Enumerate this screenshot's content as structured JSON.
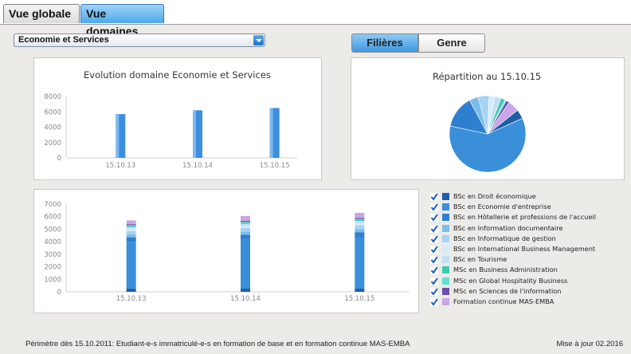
{
  "tabs": [
    {
      "label": "Vue globale",
      "active": false
    },
    {
      "label": "Vue domaines",
      "active": true
    }
  ],
  "domain_select": {
    "value": "Economie et Services"
  },
  "toggle": {
    "filieres": "Filières",
    "genre": "Genre",
    "active": "Filières"
  },
  "footer": {
    "note": "Périmètre dès 15.10.2011: Etudiant-e-s immatriculé-e-s en formation de base et en formation continue MAS-EMBA",
    "update": "Mise à jour 02.2016"
  },
  "chart_data": [
    {
      "type": "bar",
      "title": "Evolution domaine Economie et Services",
      "categories": [
        "15.10.13",
        "15.10.14",
        "15.10.15"
      ],
      "values": [
        5700,
        6200,
        6500
      ],
      "ylim": [
        0,
        8000
      ],
      "yticks": [
        "0",
        "2000",
        "4000",
        "6000",
        "8000"
      ],
      "color": "#3c8fdf"
    },
    {
      "type": "pie",
      "title": "Répartition au 15.10.15",
      "labels": [
        "BSc en Droit économique",
        "BSc en Economie d'entreprise",
        "BSc en Hôtellerie et professions de l'accueil",
        "BSc en Information documentaire",
        "BSc en Informatique de gestion",
        "BSc en International Business Management",
        "BSc en Tourisme",
        "MSc en Business Administration",
        "MSc en Global Hospitality Business",
        "MSc en Sciences de l'information",
        "Formation continue MAS-EMBA"
      ],
      "values": [
        260,
        3900,
        900,
        250,
        300,
        150,
        180,
        120,
        40,
        90,
        310
      ],
      "colors": [
        "#1f5ea8",
        "#3a8fd8",
        "#2f7fd0",
        "#7cbcec",
        "#a6d3f4",
        "#d5ebfb",
        "#c3dff5",
        "#3ec9b5",
        "#5fe0d0",
        "#6a4fb0",
        "#c9a6e6"
      ]
    },
    {
      "type": "bar",
      "stacked": true,
      "categories": [
        "15.10.13",
        "15.10.14",
        "15.10.15"
      ],
      "ylim": [
        0,
        7000
      ],
      "yticks": [
        "0",
        "1000",
        "2000",
        "3000",
        "4000",
        "5000",
        "6000",
        "7000"
      ],
      "series": [
        {
          "name": "BSc en Droit économique",
          "color": "#1f5ea8",
          "values": [
            250,
            255,
            260
          ]
        },
        {
          "name": "BSc en Economie d'entreprise",
          "color": "#3a8fd8",
          "values": [
            3750,
            3950,
            4100
          ]
        },
        {
          "name": "BSc en Hôtellerie et professions de l'accueil",
          "color": "#2f7fd0",
          "values": [
            350,
            350,
            400
          ]
        },
        {
          "name": "BSc en Information documentaire",
          "color": "#7cbcec",
          "values": [
            230,
            240,
            250
          ]
        },
        {
          "name": "BSc en Informatique de gestion",
          "color": "#a6d3f4",
          "values": [
            280,
            300,
            300
          ]
        },
        {
          "name": "BSc en International Business Management",
          "color": "#d5ebfb",
          "values": [
            150,
            160,
            160
          ]
        },
        {
          "name": "BSc en Tourisme",
          "color": "#c3dff5",
          "values": [
            170,
            180,
            180
          ]
        },
        {
          "name": "MSc en Business Administration",
          "color": "#3ec9b5",
          "values": [
            110,
            120,
            120
          ]
        },
        {
          "name": "MSc en Global Hospitality Business",
          "color": "#5fe0d0",
          "values": [
            30,
            35,
            40
          ]
        },
        {
          "name": "MSc en Sciences de l'information",
          "color": "#6a4fb0",
          "values": [
            80,
            85,
            90
          ]
        },
        {
          "name": "Formation continue MAS-EMBA",
          "color": "#c9a6e6",
          "values": [
            300,
            375,
            400
          ]
        }
      ]
    }
  ]
}
